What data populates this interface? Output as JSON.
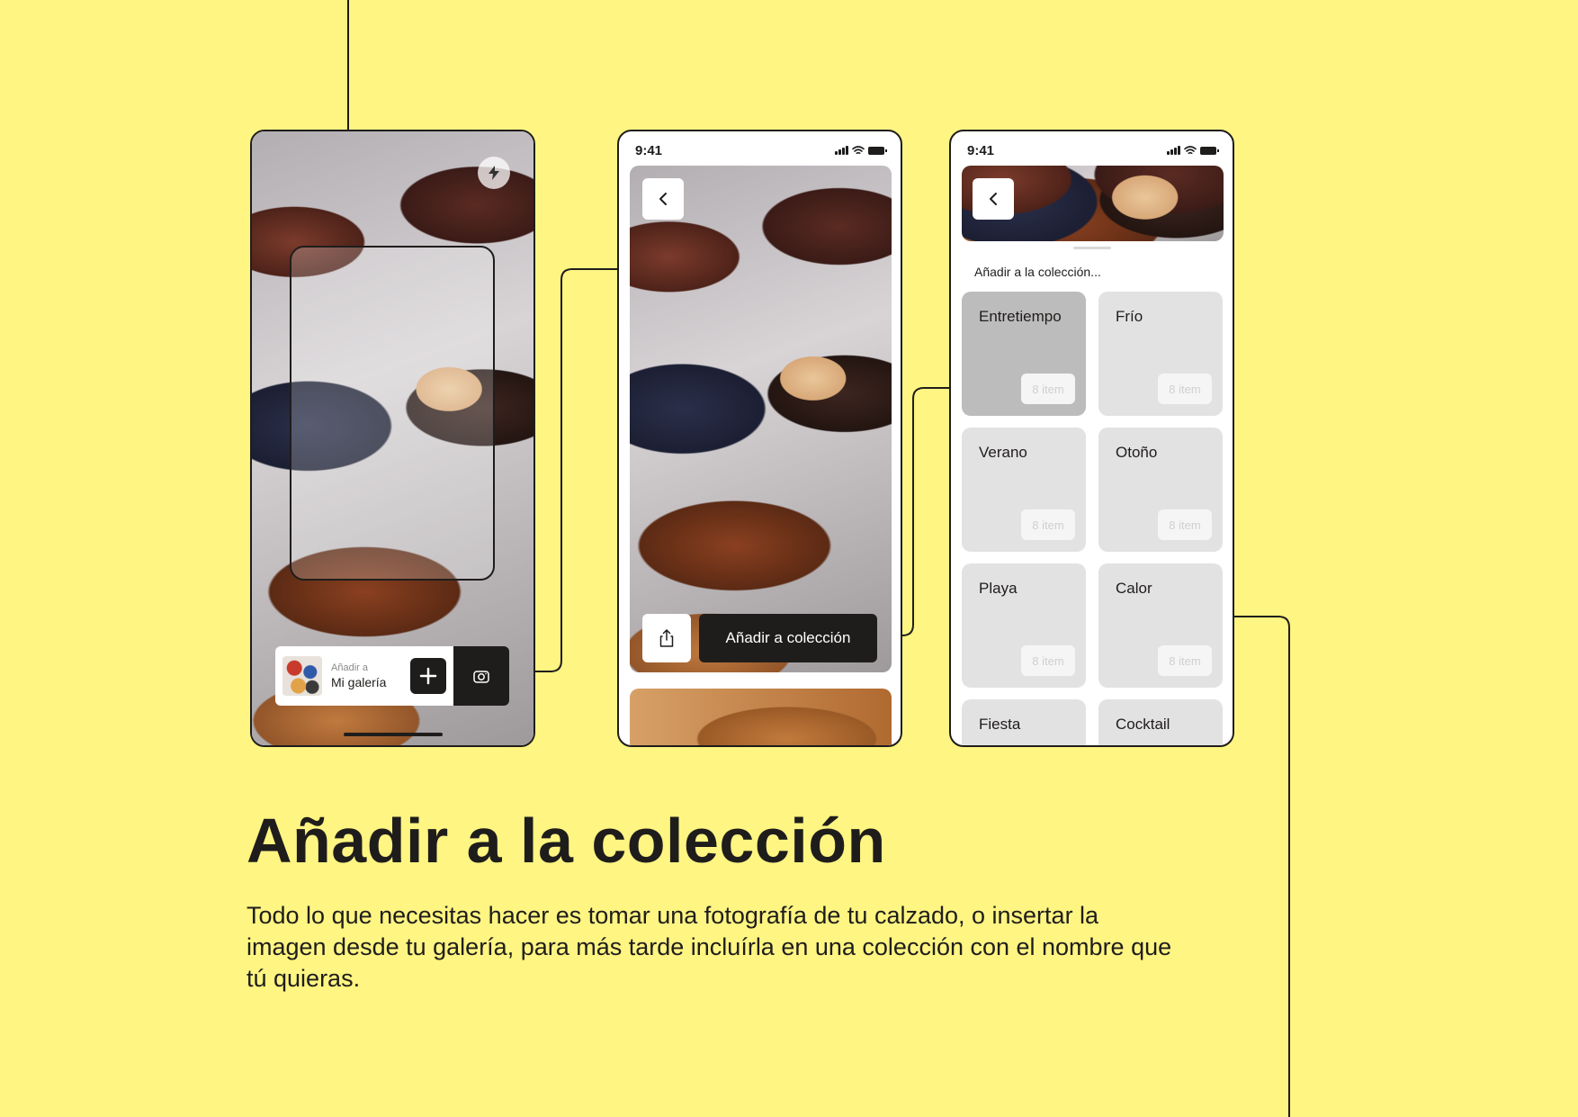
{
  "colors": {
    "background": "#FEF582",
    "ink": "#1F1D1C",
    "tile": "#E3E2E2",
    "tile_selected": "#BDBCBC"
  },
  "screen_camera": {
    "flash_icon": "lightning-icon",
    "gallery_subtitle": "Añadir a",
    "gallery_title": "Mi galería",
    "add_icon": "plus-icon",
    "camera_icon": "camera-icon"
  },
  "screen_preview": {
    "status_time": "9:41",
    "back_icon": "chevron-left-icon",
    "share_icon": "share-icon",
    "add_button_label": "Añadir a colección"
  },
  "screen_collections": {
    "status_time": "9:41",
    "back_icon": "chevron-left-icon",
    "sheet_title": "Añadir a la colección...",
    "collections": [
      {
        "name": "Entretiempo",
        "count": "8 item",
        "selected": true
      },
      {
        "name": "Frío",
        "count": "8 item",
        "selected": false
      },
      {
        "name": "Verano",
        "count": "8 item",
        "selected": false
      },
      {
        "name": "Otoño",
        "count": "8 item",
        "selected": false
      },
      {
        "name": "Playa",
        "count": "8 item",
        "selected": false
      },
      {
        "name": "Calor",
        "count": "8 item",
        "selected": false
      },
      {
        "name": "Fiesta",
        "count": "",
        "selected": false
      },
      {
        "name": "Cocktail",
        "count": "",
        "selected": false
      }
    ]
  },
  "headline": "Añadir a la colección",
  "description": "Todo lo que necesitas hacer es tomar una fotografía de tu calzado, o insertar la imagen desde tu galería, para más tarde incluírla en una colección con el nombre que tú quieras."
}
